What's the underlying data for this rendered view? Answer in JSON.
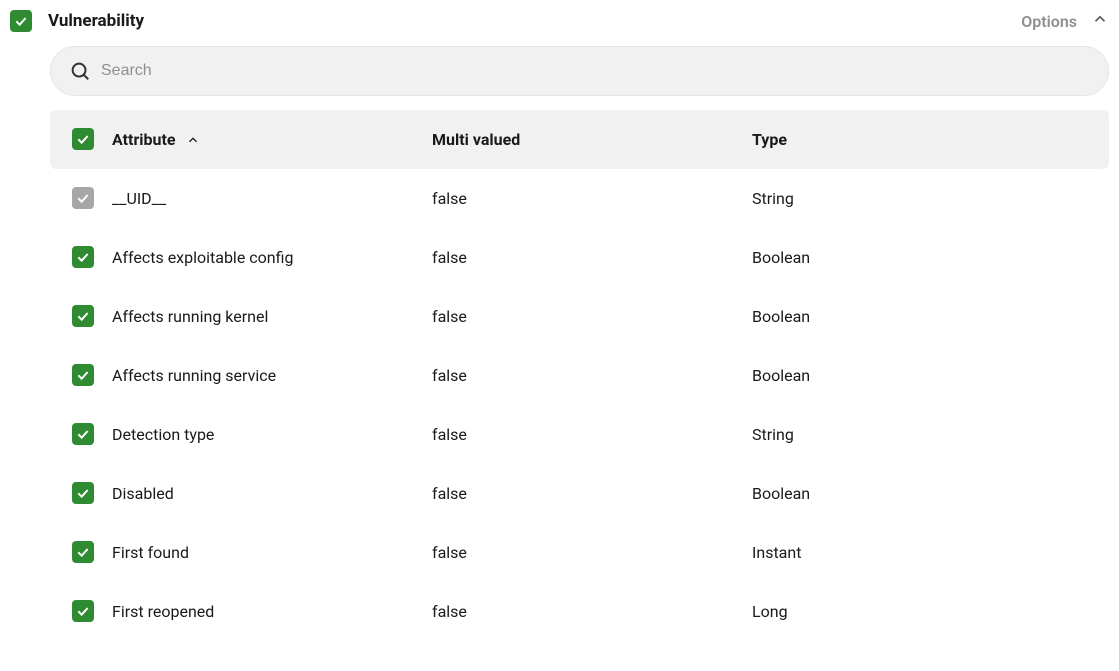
{
  "header": {
    "title": "Vulnerability",
    "options_label": "Options"
  },
  "search": {
    "placeholder": "Search"
  },
  "table": {
    "columns": {
      "attribute": "Attribute",
      "multi_valued": "Multi valued",
      "type": "Type"
    },
    "rows": [
      {
        "attribute": "__UID__",
        "multi_valued": "false",
        "type": "String",
        "checked": true,
        "grey": true
      },
      {
        "attribute": "Affects exploitable config",
        "multi_valued": "false",
        "type": "Boolean",
        "checked": true,
        "grey": false
      },
      {
        "attribute": "Affects running kernel",
        "multi_valued": "false",
        "type": "Boolean",
        "checked": true,
        "grey": false
      },
      {
        "attribute": "Affects running service",
        "multi_valued": "false",
        "type": "Boolean",
        "checked": true,
        "grey": false
      },
      {
        "attribute": "Detection type",
        "multi_valued": "false",
        "type": "String",
        "checked": true,
        "grey": false
      },
      {
        "attribute": "Disabled",
        "multi_valued": "false",
        "type": "Boolean",
        "checked": true,
        "grey": false
      },
      {
        "attribute": "First found",
        "multi_valued": "false",
        "type": "Instant",
        "checked": true,
        "grey": false
      },
      {
        "attribute": "First reopened",
        "multi_valued": "false",
        "type": "Long",
        "checked": true,
        "grey": false
      }
    ]
  }
}
